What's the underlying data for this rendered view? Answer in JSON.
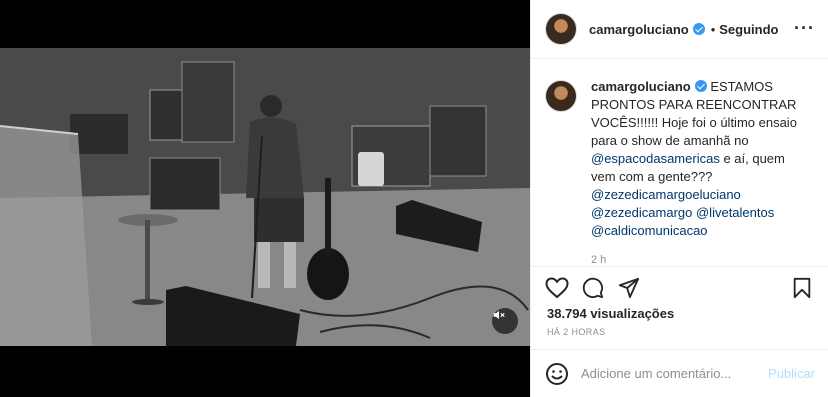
{
  "post": {
    "username": "camargoluciano",
    "following_label": "Seguindo",
    "caption_text": "ESTAMOS PRONTOS PARA REENCONTRAR VOCÊS!!!!!! Hoje foi o último ensaio para o show de amanhã no",
    "caption_mention": "@espacodasamericas",
    "caption_tail": " e aí, quem vem com a gente???",
    "mention_1": "@zezedicamargoeluciano",
    "mention_2": "@zezedicamargo",
    "mention_3": "@livetalentos",
    "mention_4": "@caldicomunicacao",
    "time_ago": "2 h",
    "views": "38.794 visualizações",
    "posted_ago": "HÁ 2 HORAS"
  },
  "comment_box": {
    "placeholder": "Adicione um comentário...",
    "publish_label": "Publicar"
  },
  "colors": {
    "verified": "#3897f0",
    "mention": "#00376b",
    "publish_disabled": "#b2dffc"
  },
  "icons": [
    "heart-icon",
    "comment-icon",
    "share-icon",
    "bookmark-icon",
    "emoji-icon",
    "mute-icon",
    "more-icon",
    "verified-icon"
  ]
}
